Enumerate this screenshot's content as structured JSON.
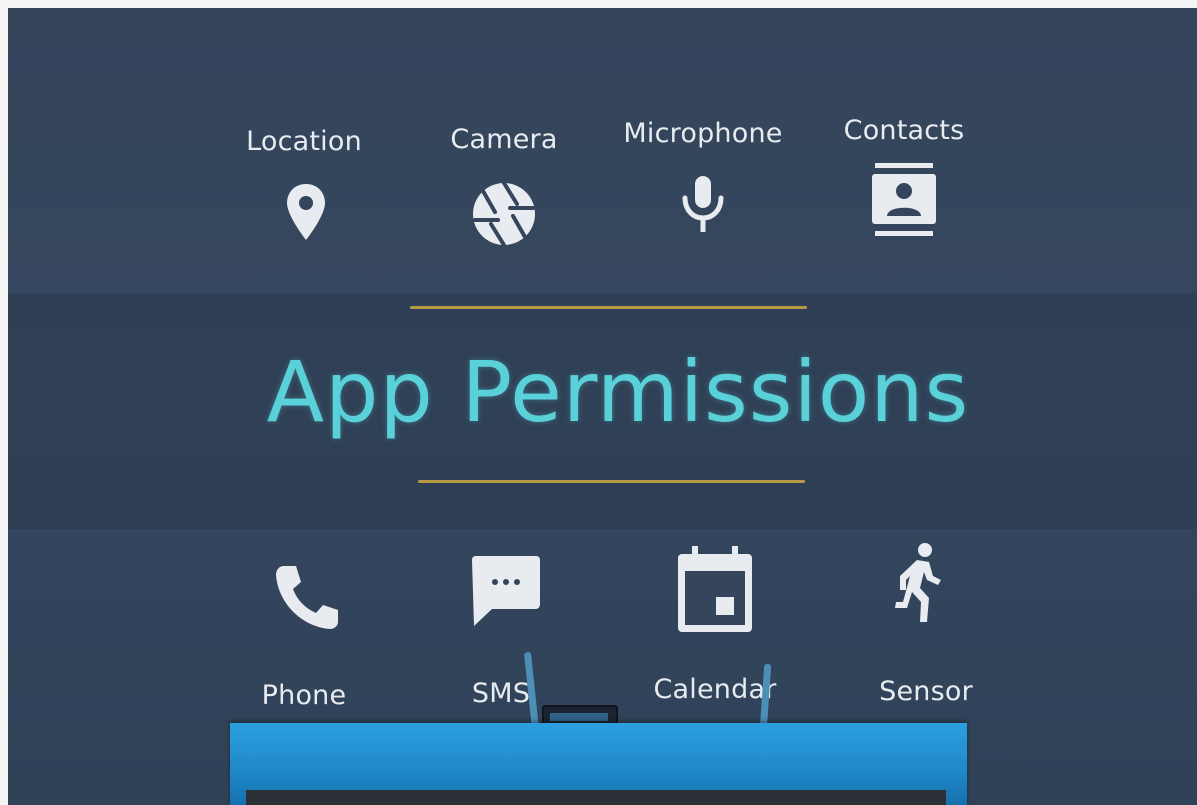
{
  "slide": {
    "title": "App Permissions",
    "colors": {
      "background": "#34455c",
      "title": "#5ad1d9",
      "rule": "#b49a45",
      "icon": "#e8ebef",
      "podium": "#2392d3"
    }
  },
  "permissions_top": [
    {
      "label": "Location",
      "icon": "location-pin-icon"
    },
    {
      "label": "Camera",
      "icon": "camera-aperture-icon"
    },
    {
      "label": "Microphone",
      "icon": "microphone-icon"
    },
    {
      "label": "Contacts",
      "icon": "contacts-card-icon"
    }
  ],
  "permissions_bottom": [
    {
      "label": "Phone",
      "icon": "phone-handset-icon"
    },
    {
      "label": "SMS",
      "icon": "sms-bubble-icon"
    },
    {
      "label": "Calendar",
      "icon": "calendar-icon"
    },
    {
      "label": "Sensor",
      "icon": "running-person-icon"
    }
  ]
}
